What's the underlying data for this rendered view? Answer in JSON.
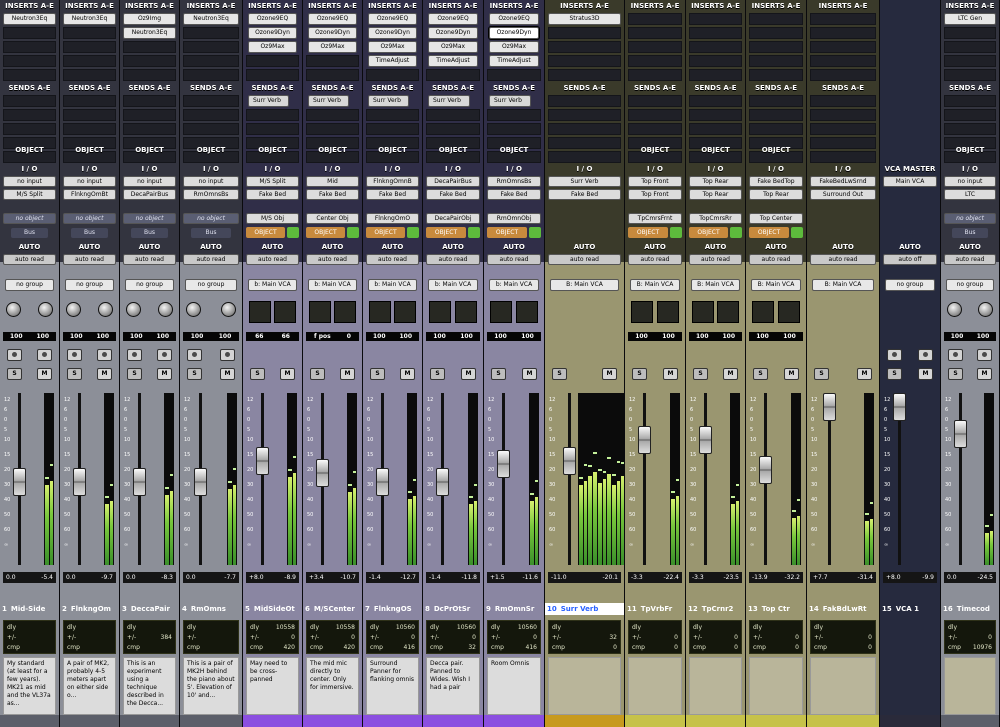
{
  "section_labels": {
    "inserts": "INSERTS A-E",
    "sends": "SENDS A-E",
    "object": "OBJECT",
    "io": "I / O",
    "auto": "AUTO",
    "vca_master": "VCA MASTER"
  },
  "scale_marks": [
    "12",
    "6",
    "0",
    "5",
    "10",
    "15",
    "20",
    "30",
    "40",
    "50",
    "60",
    "∞"
  ],
  "pan_link_label": "Bus",
  "colors": {
    "default_strip": "#8c8f98",
    "default_bottom": "#5c5f6a",
    "purple_strip": "#8a86a2",
    "purple_bottom": "#5a4fa2",
    "purple_tab": "#8b4fe0",
    "olive_strip": "#9a9670",
    "olive_tab": "#c6c24a",
    "amber_tab": "#c79a1e",
    "vca_strip": "#262a3e",
    "vca_tab": "#2a2a3a",
    "name_highlight": "#ffffff",
    "name_highlight_text": "#2a62ff"
  },
  "strips": [
    {
      "kind": "mono",
      "number": "1",
      "name": "Mid-Side",
      "inserts": [
        "Neutron3Eq"
      ],
      "sends": [],
      "object": null,
      "io_in": "no input",
      "io_out": "M/S Split",
      "io3": "no object",
      "auto": "auto read",
      "group": "no group",
      "pan": [
        "100",
        "100"
      ],
      "readout": [
        "0.0",
        "-5.4"
      ],
      "dly": [
        "",
        "",
        ""
      ],
      "comment": "My standard (at least for a few years). MK21 as mid and the VL37a as...",
      "fader": 0.5,
      "meter": 0.55,
      "tab": "default"
    },
    {
      "kind": "mono",
      "number": "2",
      "name": "FlnkngOm",
      "inserts": [
        "Neutron3Eq"
      ],
      "sends": [],
      "object": null,
      "io_in": "no input",
      "io_out": "FlnkngOmBt",
      "io3": "no object",
      "auto": "auto read",
      "group": "no group",
      "pan": [
        "100",
        "100"
      ],
      "readout": [
        "0.0",
        "-9.7"
      ],
      "dly": [
        "",
        "",
        ""
      ],
      "comment": "A pair of MK2, probably 4-5 meters apart on either side o...",
      "fader": 0.5,
      "meter": 0.42,
      "tab": "default"
    },
    {
      "kind": "mono",
      "number": "3",
      "name": "DeccaPair",
      "inserts": [
        "Oz9Img",
        "Neutron3Eq"
      ],
      "sends": [],
      "object": null,
      "io_in": "no input",
      "io_out": "DecaPairBus",
      "io3": "no object",
      "auto": "auto read",
      "group": "no group",
      "pan": [
        "100",
        "100"
      ],
      "readout": [
        "0.0",
        "-8.3"
      ],
      "dly": [
        "",
        "384",
        ""
      ],
      "comment": "This is an experiment using a technique described in the Decca...",
      "fader": 0.5,
      "meter": 0.48,
      "tab": "default"
    },
    {
      "kind": "mono",
      "number": "4",
      "name": "RmOmns",
      "inserts": [
        "Neutron3Eq"
      ],
      "sends": [],
      "object": null,
      "io_in": "no input",
      "io_out": "RmOmnsBs",
      "io3": "no object",
      "auto": "auto read",
      "group": "no group",
      "pan": [
        "100",
        "100"
      ],
      "readout": [
        "0.0",
        "-7.7"
      ],
      "dly": [
        "",
        "",
        ""
      ],
      "comment": "This is a pair of MK2H behind the piano about 5'. Elevation of 10' and...",
      "fader": 0.5,
      "meter": 0.52,
      "tab": "default"
    },
    {
      "kind": "bus",
      "number": "5",
      "name": "MidSideOt",
      "inserts": [
        "Ozone9EQ",
        "Ozone9Dyn",
        "Oz9Max"
      ],
      "sends": [
        "Surr Verb"
      ],
      "io_in": "M/S Split",
      "io_out": "Fake Bed",
      "io3": "M/S Obj",
      "auto": "auto read",
      "group": "b: Main VCA",
      "pan": [
        "66",
        "66"
      ],
      "readout": [
        "+8.0",
        "-8.9"
      ],
      "dly": [
        "10558",
        "0",
        "420"
      ],
      "comment": "May need to be cross-panned",
      "fader": 0.36,
      "meter": 0.6,
      "tab": "purple"
    },
    {
      "kind": "bus",
      "number": "6",
      "name": "M/SCenter",
      "inserts": [
        "Ozone9EQ",
        "Ozone9Dyn",
        "Oz9Max"
      ],
      "sends": [
        "Surr Verb"
      ],
      "io_in": "Mid",
      "io_out": "Fake Bed",
      "io3": "Center Obj",
      "auto": "auto read",
      "group": "b: Main VCA",
      "pan": [
        "f pos",
        "0"
      ],
      "readout": [
        "+3.4",
        "-10.7"
      ],
      "dly": [
        "10558",
        "0",
        "420"
      ],
      "comment": "The mid mic directly to center. Only for immersive.",
      "fader": 0.44,
      "meter": 0.5,
      "tab": "purple"
    },
    {
      "kind": "bus",
      "number": "7",
      "name": "FlnkngOS",
      "inserts": [
        "Ozone9EQ",
        "Ozone9Dyn",
        "Oz9Max",
        "TimeAdjust"
      ],
      "sends": [
        "Surr Verb"
      ],
      "io_in": "FlnkngOmnB",
      "io_out": "Fake Bed",
      "io3": "FlnkngOmO",
      "auto": "auto read",
      "group": "b: Main VCA",
      "pan": [
        "100",
        "100"
      ],
      "readout": [
        "-1.4",
        "-12.7"
      ],
      "dly": [
        "10560",
        "0",
        "416"
      ],
      "comment": "Surround Panner for flanking omnis",
      "fader": 0.5,
      "meter": 0.45,
      "tab": "purple"
    },
    {
      "kind": "bus",
      "number": "8",
      "name": "DcPrOtSr",
      "inserts": [
        "Ozone9EQ",
        "Ozone9Dyn",
        "Oz9Max",
        "TimeAdjust"
      ],
      "sends": [
        "Surr Verb"
      ],
      "io_in": "DecaPairBus",
      "io_out": "Fake Bed",
      "io3": "DecaPairObj",
      "auto": "auto read",
      "group": "b: Main VCA",
      "pan": [
        "100",
        "100"
      ],
      "readout": [
        "-1.4",
        "-11.8"
      ],
      "dly": [
        "10560",
        "0",
        "32"
      ],
      "comment": "Decca pair. Panned to Wides. Wish I had a pair",
      "fader": 0.5,
      "meter": 0.42,
      "tab": "purple"
    },
    {
      "kind": "bus",
      "number": "9",
      "name": "RmOmnSr",
      "inserts": [
        "Ozone9EQ",
        "Ozone9Dyn",
        "Oz9Max",
        "TimeAdjust"
      ],
      "sends": [
        "Surr Verb"
      ],
      "io_in": "RmOmnsBs",
      "io_out": "Fake Bed",
      "io3": "RmOmnObj",
      "auto": "auto read",
      "group": "b: Main VCA",
      "pan": [
        "100",
        "100"
      ],
      "readout": [
        "+1.5",
        "-11.6"
      ],
      "dly": [
        "10560",
        "0",
        "416"
      ],
      "comment": "Room Omnis",
      "fader": 0.38,
      "meter": 0.44,
      "tab": "purple"
    },
    {
      "kind": "surr",
      "number": "10",
      "name": "Surr Verb",
      "inserts": [
        "Stratus3D"
      ],
      "sends": [],
      "io_in": "Surr Verb",
      "io_out": "Fake Bed",
      "io3": "",
      "auto": "auto read",
      "group": "B: Main VCA",
      "pan": [],
      "readout": [
        "-11.0",
        "-20.1"
      ],
      "dly": [
        "",
        "32",
        "0"
      ],
      "comment": "",
      "fader": 0.36,
      "meter": 0.55,
      "tab": "amber"
    },
    {
      "kind": "bus",
      "number": "11",
      "name": "TpVrbFr",
      "inserts": [],
      "sends": [],
      "io_in": "Top Front",
      "io_out": "Top Front",
      "io3": "TpCmrsFrnt",
      "auto": "auto read",
      "group": "B: Main VCA",
      "pan": [
        "100",
        "100"
      ],
      "readout": [
        "-3.3",
        "-22.4"
      ],
      "dly": [
        "",
        "0",
        "0"
      ],
      "comment": "",
      "fader": 0.22,
      "meter": 0.45,
      "tab": "olive"
    },
    {
      "kind": "bus",
      "number": "12",
      "name": "TpCrnr2",
      "inserts": [],
      "sends": [],
      "io_in": "Top Rear",
      "io_out": "Top Rear",
      "io3": "TopCmrsRr",
      "auto": "auto read",
      "group": "B: Main VCA",
      "pan": [
        "100",
        "100"
      ],
      "readout": [
        "-3.3",
        "-23.5"
      ],
      "dly": [
        "",
        "0",
        "0"
      ],
      "comment": "",
      "fader": 0.22,
      "meter": 0.42,
      "tab": "olive"
    },
    {
      "kind": "bus",
      "number": "13",
      "name": "Top Ctr",
      "inserts": [],
      "sends": [],
      "io_in": "Fake BedTop",
      "io_out": "Top Rear",
      "io3": "Top Center",
      "auto": "auto read",
      "group": "B: Main VCA",
      "pan": [
        "100",
        "100"
      ],
      "readout": [
        "-13.9",
        "-32.2"
      ],
      "dly": [
        "",
        "0",
        "0"
      ],
      "comment": "",
      "fader": 0.42,
      "meter": 0.32,
      "tab": "olive"
    },
    {
      "kind": "aux",
      "number": "14",
      "name": "FakBdLwRt",
      "inserts": [],
      "sends": [],
      "io_in": "FakeBedLwSrnd",
      "io_out": "Surround Out",
      "io3": "",
      "auto": "auto read",
      "group": "B: Main VCA",
      "pan": [],
      "readout": [
        "+7.7",
        "-31.4"
      ],
      "dly": [
        "",
        "0",
        "0"
      ],
      "comment": "",
      "fader": 0.0,
      "meter": 0.3,
      "tab": "olive"
    },
    {
      "kind": "vca",
      "number": "15",
      "name": "VCA 1",
      "inserts": [],
      "sends": [],
      "io_in": "Main VCA",
      "io_out": "",
      "io3": "",
      "auto": "auto off",
      "group": "no group",
      "pan": [],
      "readout": [
        "+8.0",
        "-9.9"
      ],
      "dly": [
        "",
        "",
        ""
      ],
      "comment": "",
      "fader": 0.0,
      "meter": 0,
      "tab": "vca"
    },
    {
      "kind": "mono",
      "number": "16",
      "name": "Timecod",
      "inserts": [
        "LTC Gen"
      ],
      "sends": [],
      "io_in": "no input",
      "io_out": "LTC",
      "io3": "no object",
      "auto": "auto read",
      "group": "no group",
      "pan": [
        "100",
        "100"
      ],
      "readout": [
        "0.0",
        "-24.5"
      ],
      "dly": [
        "",
        "0",
        "10976"
      ],
      "comment": "",
      "fader": 0.18,
      "meter": 0.22,
      "tab": "default"
    }
  ]
}
